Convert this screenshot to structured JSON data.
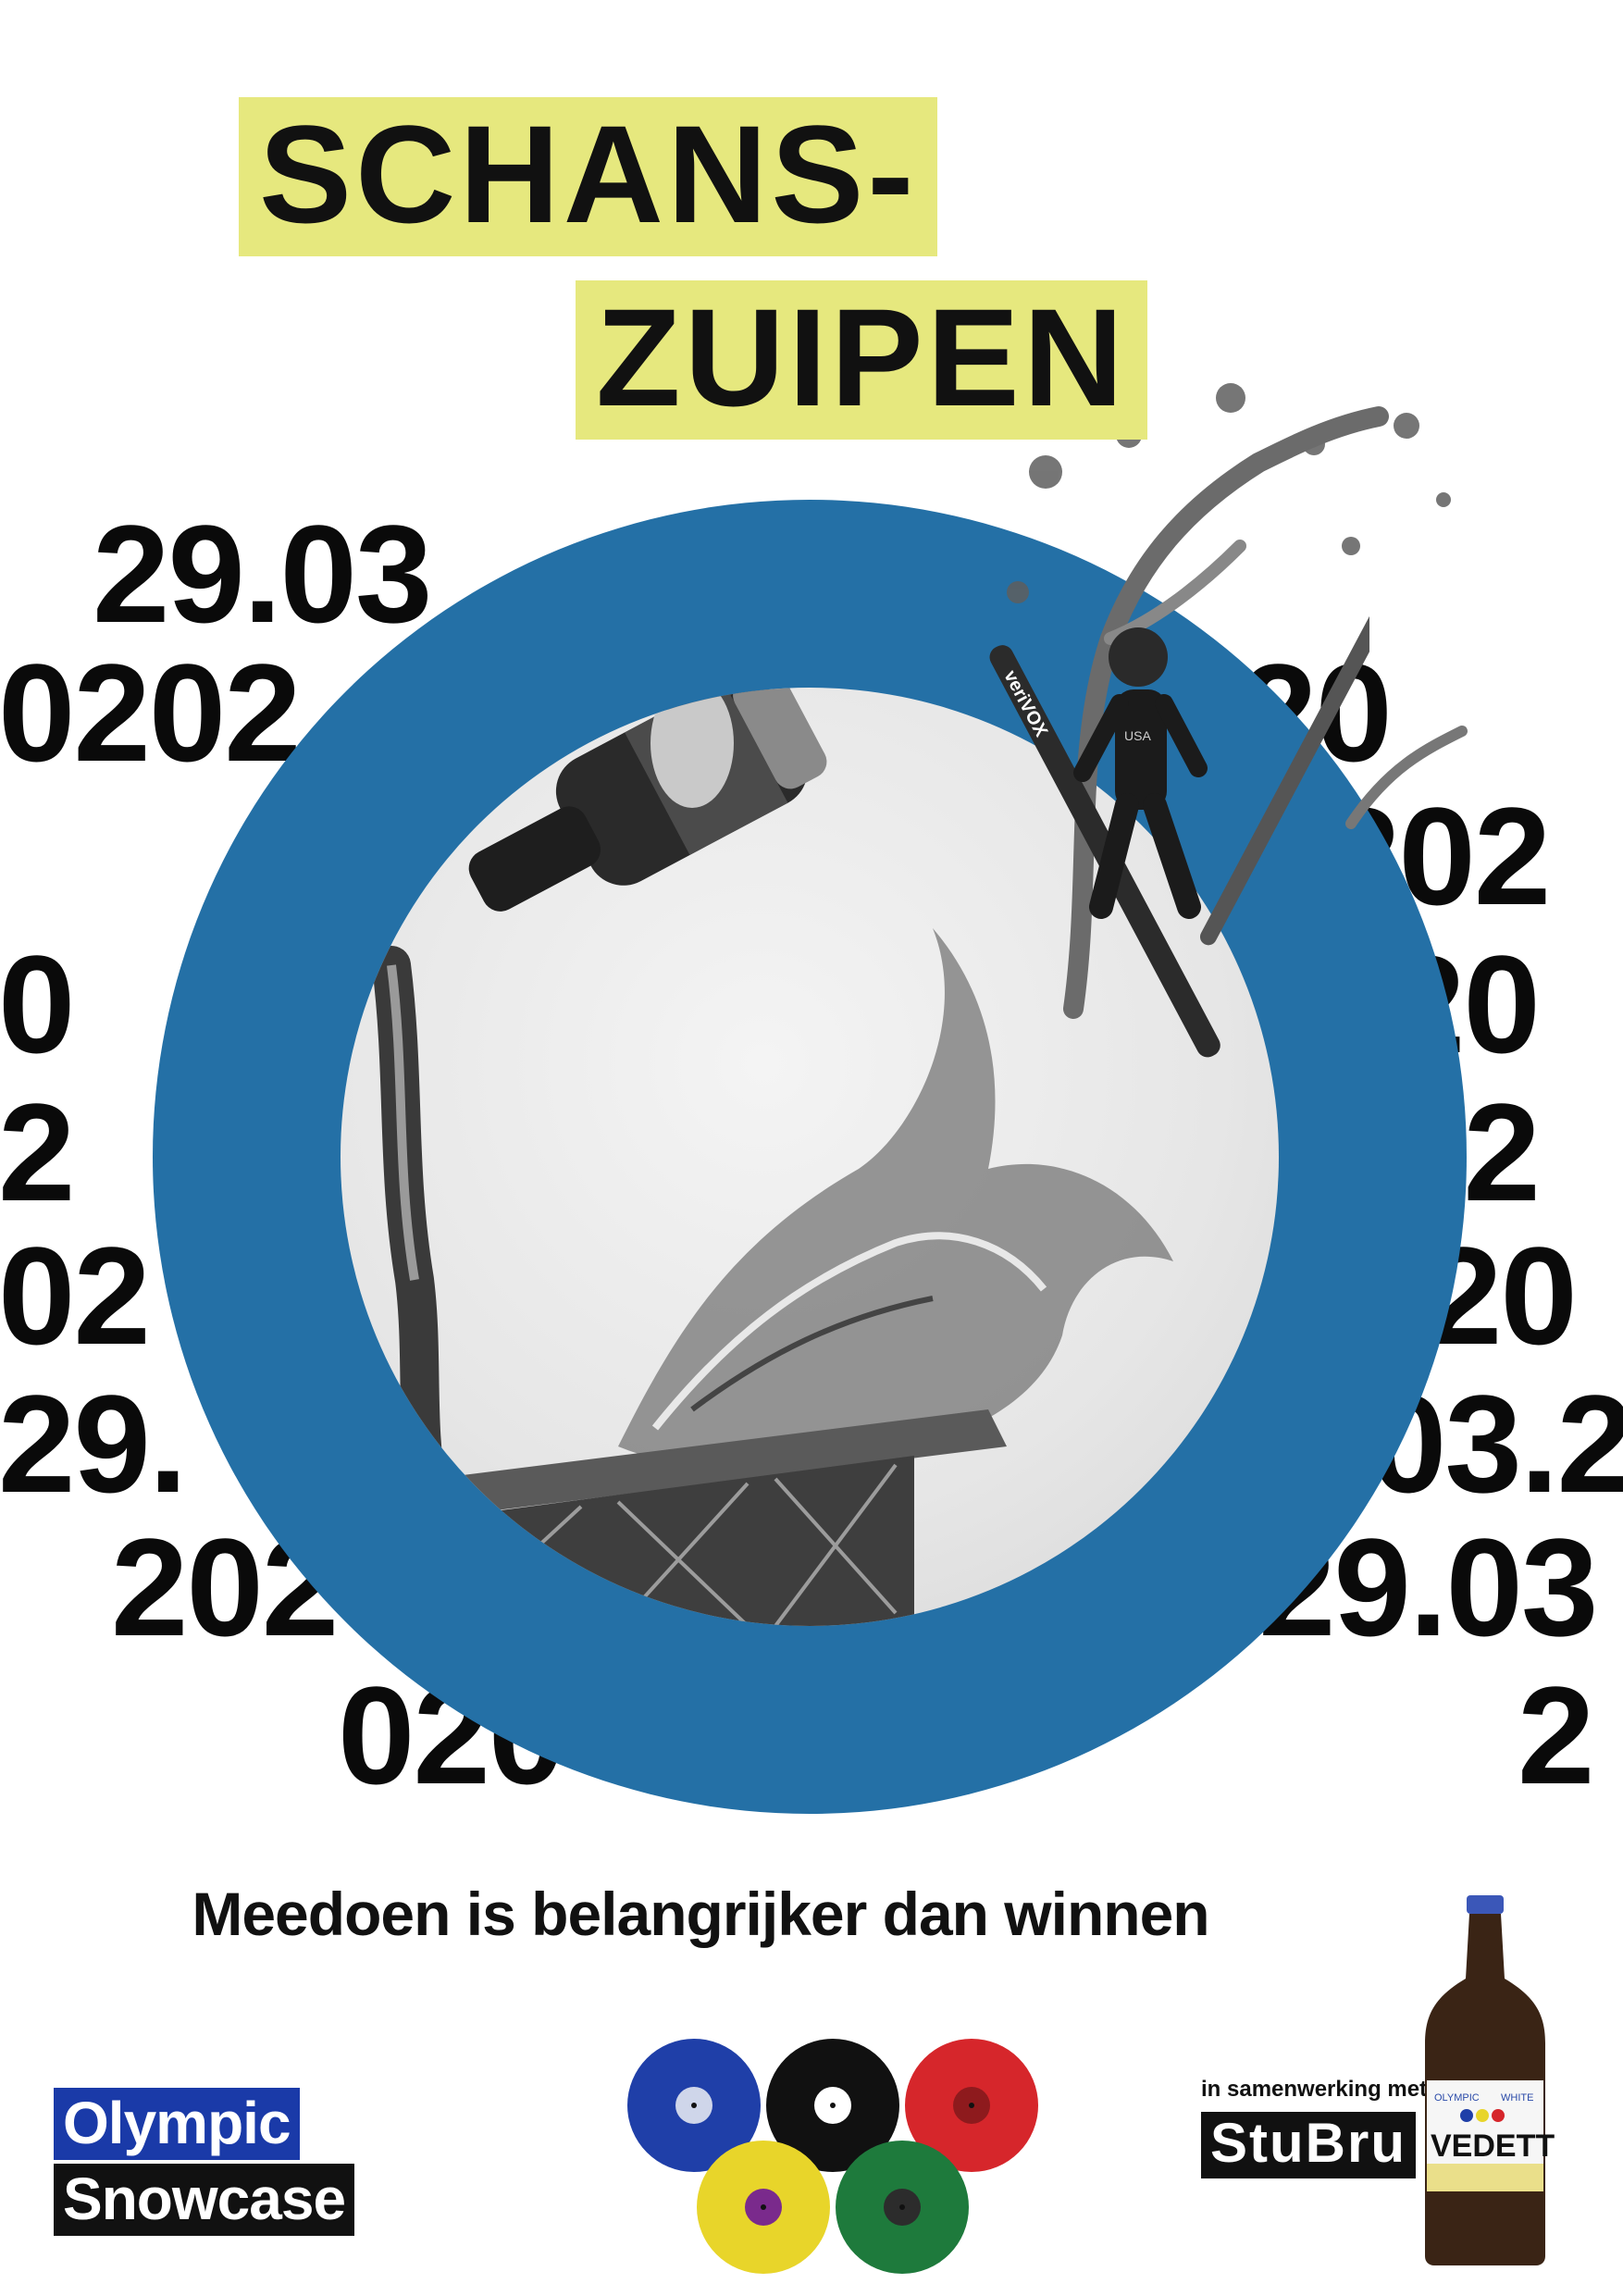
{
  "poster": {
    "title_line1": "SCHANS-",
    "title_line2": "ZUIPEN",
    "date_fragments": [
      "29.03",
      "0202",
      "20",
      "202",
      "0",
      "20",
      "2",
      "02",
      "02",
      "20",
      "29.",
      "03.2",
      "202",
      "29.03",
      "020",
      "2"
    ],
    "tagline": "Meedoen is belangrijker dan winnen",
    "ski_brand": "veriVOX",
    "suit_text": "USA",
    "colors": {
      "title_highlight": "#e6e87e",
      "ring": "#2470a6",
      "olympic_logo_blue": "#1a3aa8",
      "record_colors": [
        "#1f3fa8",
        "#111111",
        "#d6262b",
        "#e8d52a",
        "#1e7a3c"
      ]
    }
  },
  "footer": {
    "logo_left_line1": "Olympic",
    "logo_left_line2": "Snowcase",
    "partner_text": "in samenwerking met",
    "partner_logo": "StuBru",
    "bottle_label": "VEDETT",
    "bottle_small_left": "OLYMPIC",
    "bottle_small_right": "WHITE"
  }
}
